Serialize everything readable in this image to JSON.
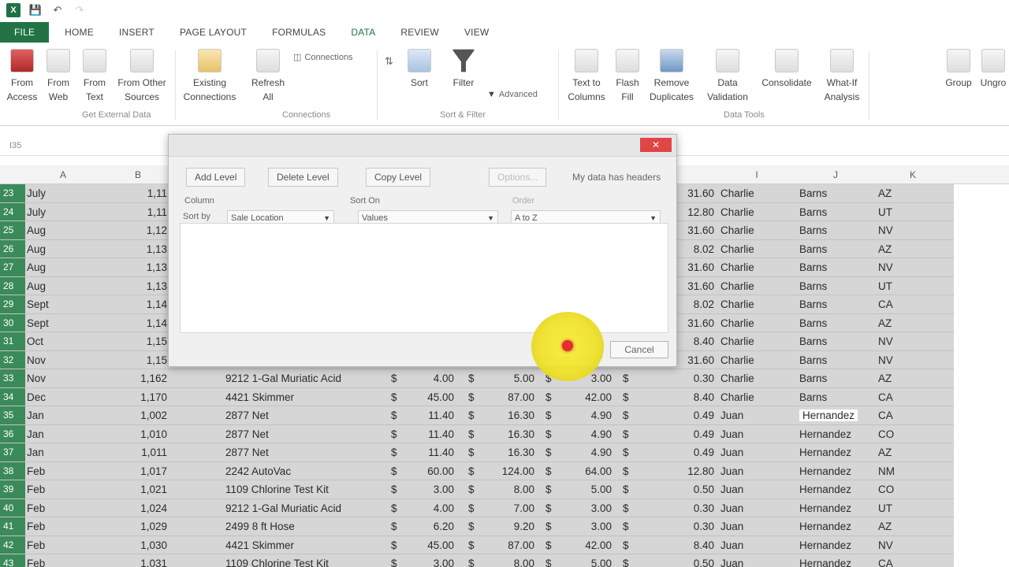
{
  "qat": {
    "undo_icon": "undo-icon",
    "save_icon": "save-icon"
  },
  "tabs": [
    {
      "label": "FILE"
    },
    {
      "label": "HOME"
    },
    {
      "label": "INSERT"
    },
    {
      "label": "PAGE LAYOUT"
    },
    {
      "label": "FORMULAS"
    },
    {
      "label": "DATA"
    },
    {
      "label": "REVIEW"
    },
    {
      "label": "VIEW"
    }
  ],
  "ribbon": {
    "from_access": "From Access",
    "from_web": "From Web",
    "from_text": "From Text",
    "from_other": "From Other Sources",
    "existing": "Existing Connections",
    "refresh": "Refresh All",
    "connections": "Connections",
    "sort": "Sort",
    "filter": "Filter",
    "advanced": "Advanced",
    "text_to_columns": "Text to Columns",
    "flash_fill": "Flash Fill",
    "remove_duplicates": "Remove Duplicates",
    "data_validation": "Data Validation",
    "consolidate": "Consolidate",
    "what_if": "What-If Analysis",
    "group": "Group",
    "ungroup": "Ungro",
    "grp_external": "Get External Data",
    "grp_connections": "Connections",
    "grp_sort_filter": "Sort & Filter",
    "grp_data_tools": "Data Tools"
  },
  "namebox": "I35",
  "columns": [
    "A",
    "B",
    "I",
    "J",
    "K"
  ],
  "dialog": {
    "add_level": "Add Level",
    "delete_level": "Delete Level",
    "copy_level": "Copy Level",
    "options": "Options...",
    "my_data_headers": "My data has headers",
    "col_header": "Column",
    "sort_on_header": "Sort On",
    "order_header": "Order",
    "sort_by": "Sort by",
    "sort_by_value": "Sale Location",
    "sort_on_value": "Values",
    "order_value": "A to Z",
    "ok": "OK",
    "cancel": "Cancel"
  },
  "rows": [
    {
      "n": "23",
      "m": "July",
      "b": "1,11",
      "amt": "31.60",
      "first": "Charlie",
      "last": "Barns",
      "st": "AZ"
    },
    {
      "n": "24",
      "m": "July",
      "b": "1,11",
      "amt": "12.80",
      "first": "Charlie",
      "last": "Barns",
      "st": "UT"
    },
    {
      "n": "25",
      "m": "Aug",
      "b": "1,12",
      "amt": "31.60",
      "first": "Charlie",
      "last": "Barns",
      "st": "NV"
    },
    {
      "n": "26",
      "m": "Aug",
      "b": "1,13",
      "amt": "8.02",
      "first": "Charlie",
      "last": "Barns",
      "st": "AZ"
    },
    {
      "n": "27",
      "m": "Aug",
      "b": "1,13",
      "amt": "31.60",
      "first": "Charlie",
      "last": "Barns",
      "st": "NV"
    },
    {
      "n": "28",
      "m": "Aug",
      "b": "1,13",
      "amt": "31.60",
      "first": "Charlie",
      "last": "Barns",
      "st": "UT"
    },
    {
      "n": "29",
      "m": "Sept",
      "b": "1,14",
      "amt": "8.02",
      "first": "Charlie",
      "last": "Barns",
      "st": "CA"
    },
    {
      "n": "30",
      "m": "Sept",
      "b": "1,14",
      "amt": "31.60",
      "first": "Charlie",
      "last": "Barns",
      "st": "AZ"
    },
    {
      "n": "31",
      "m": "Oct",
      "b": "1,15",
      "amt": "8.40",
      "first": "Charlie",
      "last": "Barns",
      "st": "NV"
    },
    {
      "n": "32",
      "m": "Nov",
      "b": "1,15",
      "amt": "31.60",
      "first": "Charlie",
      "last": "Barns",
      "st": "NV"
    },
    {
      "n": "33",
      "m": "Nov",
      "b": "1,162",
      "item": "9212 1-Gal Muriatic Acid",
      "c1": "4.00",
      "c2": "5.00",
      "c3": "3.00",
      "amt": "0.30",
      "first": "Charlie",
      "last": "Barns",
      "st": "AZ"
    },
    {
      "n": "34",
      "m": "Dec",
      "b": "1,170",
      "item": "4421 Skimmer",
      "c1": "45.00",
      "c2": "87.00",
      "c3": "42.00",
      "amt": "8.40",
      "first": "Charlie",
      "last": "Barns",
      "st": "CA"
    },
    {
      "n": "35",
      "m": "Jan",
      "b": "1,002",
      "item": "2877 Net",
      "c1": "11.40",
      "c2": "16.30",
      "c3": "4.90",
      "amt": "0.49",
      "first": "Juan",
      "last": "Hernandez",
      "st": "CA",
      "hl": true
    },
    {
      "n": "36",
      "m": "Jan",
      "b": "1,010",
      "item": "2877 Net",
      "c1": "11.40",
      "c2": "16.30",
      "c3": "4.90",
      "amt": "0.49",
      "first": "Juan",
      "last": "Hernandez",
      "st": "CO"
    },
    {
      "n": "37",
      "m": "Jan",
      "b": "1,011",
      "item": "2877 Net",
      "c1": "11.40",
      "c2": "16.30",
      "c3": "4.90",
      "amt": "0.49",
      "first": "Juan",
      "last": "Hernandez",
      "st": "AZ"
    },
    {
      "n": "38",
      "m": "Feb",
      "b": "1,017",
      "item": "2242 AutoVac",
      "c1": "60.00",
      "c2": "124.00",
      "c3": "64.00",
      "amt": "12.80",
      "first": "Juan",
      "last": "Hernandez",
      "st": "NM"
    },
    {
      "n": "39",
      "m": "Feb",
      "b": "1,021",
      "item": "1109 Chlorine Test Kit",
      "c1": "3.00",
      "c2": "8.00",
      "c3": "5.00",
      "amt": "0.50",
      "first": "Juan",
      "last": "Hernandez",
      "st": "CO"
    },
    {
      "n": "40",
      "m": "Feb",
      "b": "1,024",
      "item": "9212 1-Gal Muriatic Acid",
      "c1": "4.00",
      "c2": "7.00",
      "c3": "3.00",
      "amt": "0.30",
      "first": "Juan",
      "last": "Hernandez",
      "st": "UT"
    },
    {
      "n": "41",
      "m": "Feb",
      "b": "1,029",
      "item": "2499 8 ft Hose",
      "c1": "6.20",
      "c2": "9.20",
      "c3": "3.00",
      "amt": "0.30",
      "first": "Juan",
      "last": "Hernandez",
      "st": "AZ"
    },
    {
      "n": "42",
      "m": "Feb",
      "b": "1,030",
      "item": "4421 Skimmer",
      "c1": "45.00",
      "c2": "87.00",
      "c3": "42.00",
      "amt": "8.40",
      "first": "Juan",
      "last": "Hernandez",
      "st": "NV"
    },
    {
      "n": "43",
      "m": "Feb",
      "b": "1,031",
      "item": "1109 Chlorine Test Kit",
      "c1": "3.00",
      "c2": "8.00",
      "c3": "5.00",
      "amt": "0.50",
      "first": "Juan",
      "last": "Hernandez",
      "st": "CA"
    }
  ],
  "currency": "$"
}
